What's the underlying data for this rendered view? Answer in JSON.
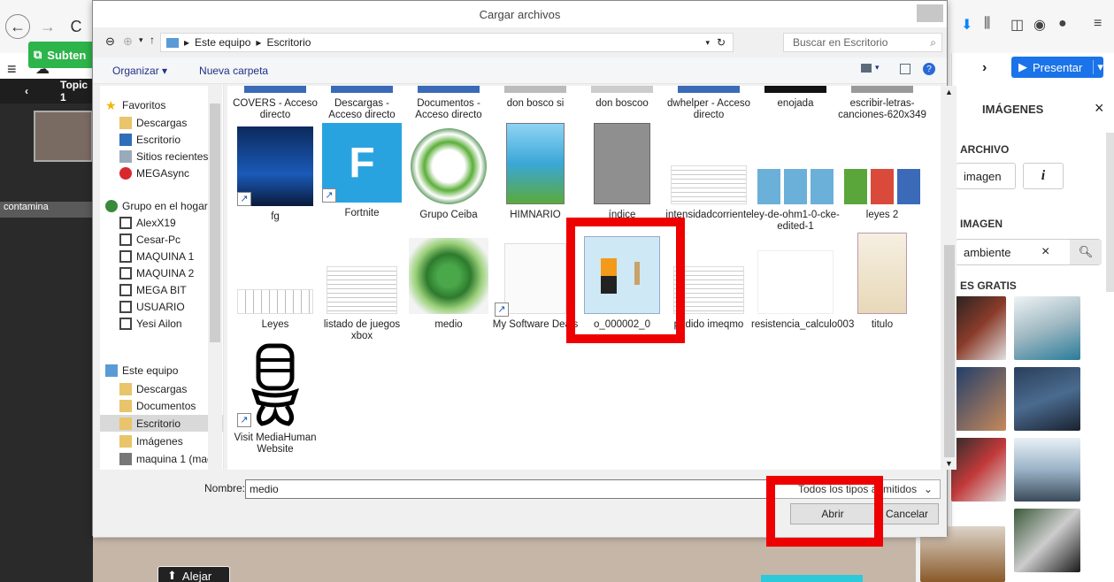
{
  "browser": {
    "back": "←",
    "forward": "→",
    "reload": "C"
  },
  "app": {
    "subtitle_button": "Subten",
    "topic_label": "Topic 1",
    "slide_label": "contamina",
    "alejar": "Alejar",
    "present_button": "Presentar"
  },
  "right_panel": {
    "title": "IMÁGENES",
    "archivo_label": "ARCHIVO",
    "imagen_button": "imagen",
    "imagen_section": "IMAGEN",
    "search_value": "ambiente",
    "gratis_label": "ES GRATIS"
  },
  "dialog": {
    "title": "Cargar archivos",
    "breadcrumb": [
      "Este equipo",
      "Escritorio"
    ],
    "search_placeholder": "Buscar en Escritorio",
    "organize": "Organizar ▾",
    "new_folder": "Nueva carpeta",
    "nav": {
      "favoritos": "Favoritos",
      "descargas": "Descargas",
      "escritorio": "Escritorio",
      "sitios": "Sitios recientes",
      "mega": "MEGAsync",
      "grupo": "Grupo en el hogar",
      "alex": "AlexX19",
      "cesar": "Cesar-Pc",
      "maq1": "MAQUINA 1",
      "maq2": "MAQUINA 2",
      "megabit": "MEGA BIT",
      "usuario": "USUARIO",
      "yesi": "Yesi Ailon",
      "equipo": "Este equipo",
      "descargas2": "Descargas",
      "documentos": "Documentos",
      "escritorio2": "Escritorio",
      "imagenes": "Imágenes",
      "maquina": "maquina 1 (mac"
    },
    "files_row1": [
      "COVERS - Acceso directo",
      "Descargas - Acceso directo",
      "Documentos - Acceso directo",
      "don bosco si",
      "don boscoo",
      "dwhelper - Acceso directo",
      "enojada",
      "escribir-letras-canciones-620x349"
    ],
    "files_row2": [
      "fg",
      "Fortnite",
      "Grupo Ceiba",
      "HIMNARIO",
      "índice",
      "intensidadcorriente",
      "ley-de-ohm1-0-cke-edited-1",
      "leyes 2"
    ],
    "files_row3": [
      "Leyes",
      "listado de juegos xbox",
      "medio",
      "My Software Deals",
      "o_000002_0",
      "pedido imeqmo",
      "resistencia_calculo003",
      "titulo"
    ],
    "files_row4": [
      "Visit MediaHuman Website"
    ],
    "nombre_label": "Nombre:",
    "nombre_value": "medio",
    "file_type": "Todos los tipos admitidos",
    "open_button": "Abrir",
    "cancel_button": "Cancelar"
  }
}
